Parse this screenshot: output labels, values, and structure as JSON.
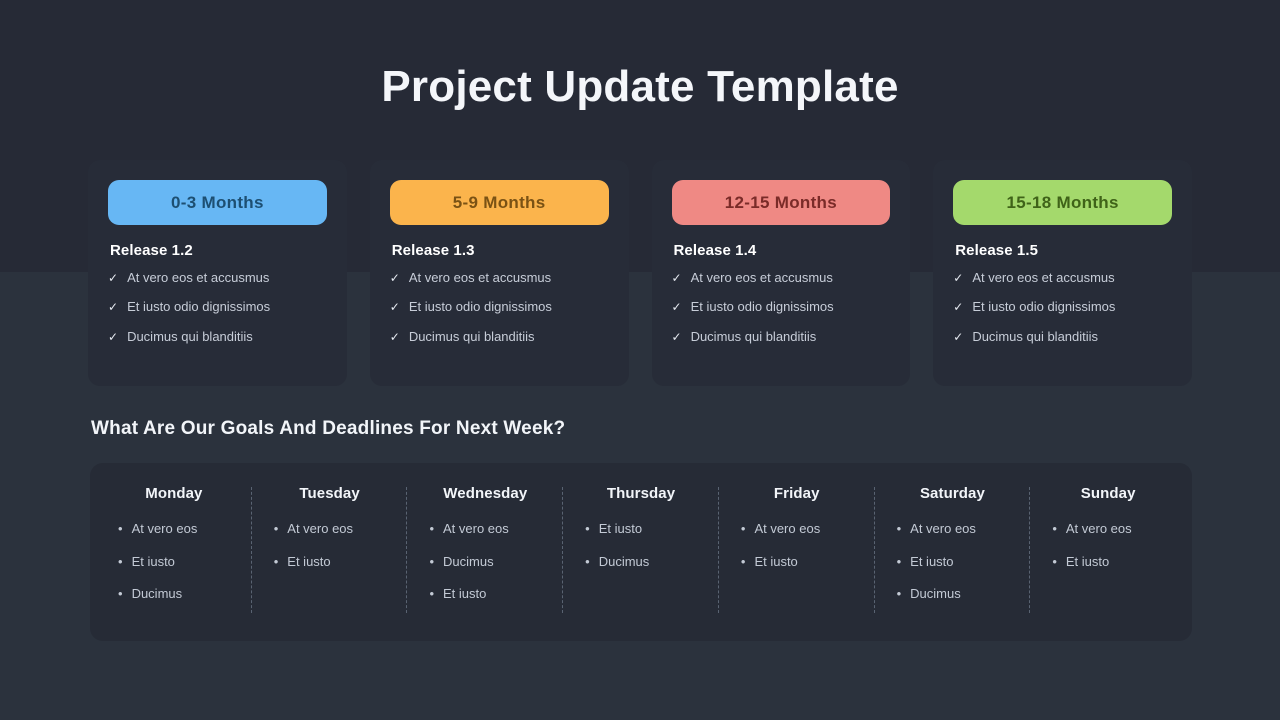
{
  "page": {
    "title": "Project Update Template",
    "bg_top_color": "#262a36",
    "bg_bottom_color": "#2b323d"
  },
  "milestones": [
    {
      "pill_label": "0-3 Months",
      "pill_color": "#67b7f4",
      "release": "Release 1.2",
      "items": [
        "At vero eos et accusmus",
        "Et iusto odio dignissimos",
        "Ducimus qui blanditiis"
      ]
    },
    {
      "pill_label": "5-9 Months",
      "pill_color": "#fbb44c",
      "release": "Release 1.3",
      "items": [
        "At vero eos et accusmus",
        "Et iusto odio dignissimos",
        "Ducimus qui blanditiis"
      ]
    },
    {
      "pill_label": "12-15 Months",
      "pill_color": "#ef8984",
      "release": "Release 1.4",
      "items": [
        "At vero eos et accusmus",
        "Et iusto odio dignissimos",
        "Ducimus qui blanditiis"
      ]
    },
    {
      "pill_label": "15-18 Months",
      "pill_color": "#a4d96c",
      "release": "Release 1.5",
      "items": [
        "At vero eos et accusmus",
        "Et iusto odio dignissimos",
        "Ducimus qui blanditiis"
      ]
    }
  ],
  "goals": {
    "heading": "What Are Our Goals And Deadlines For Next Week?",
    "days": [
      {
        "name": "Monday",
        "items": [
          "At vero eos",
          "Et iusto",
          "Ducimus"
        ]
      },
      {
        "name": "Tuesday",
        "items": [
          "At vero eos",
          "Et iusto"
        ]
      },
      {
        "name": "Wednesday",
        "items": [
          "At vero eos",
          "Ducimus",
          "Et iusto"
        ]
      },
      {
        "name": "Thursday",
        "items": [
          "Et iusto",
          "Ducimus"
        ]
      },
      {
        "name": "Friday",
        "items": [
          "At vero eos",
          "Et iusto"
        ]
      },
      {
        "name": "Saturday",
        "items": [
          "At vero eos",
          "Et iusto",
          "Ducimus"
        ]
      },
      {
        "name": "Sunday",
        "items": [
          "At vero eos",
          "Et iusto"
        ]
      }
    ]
  },
  "icons": {
    "check": "✓",
    "bullet": "•"
  }
}
